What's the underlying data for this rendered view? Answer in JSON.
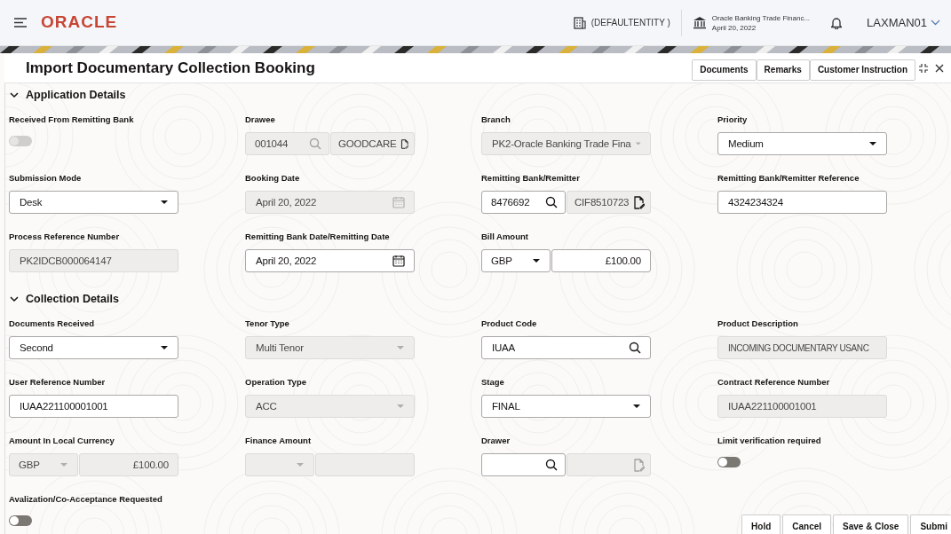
{
  "header": {
    "logo": "ORACLE",
    "entity": "(DEFAULTENTITY )",
    "branch_name": "Oracle Banking Trade Financ...",
    "branch_date": "April 20, 2022",
    "user": "LAXMAN01"
  },
  "window": {
    "title": "Import Documentary Collection Booking",
    "actions": [
      "Documents",
      "Remarks",
      "Customer Instruction"
    ]
  },
  "sections": [
    {
      "title": "Application Details",
      "expanded": true,
      "fields": [
        {
          "label": "Received From Remitting Bank",
          "kind": "toggle",
          "on": false,
          "disabled": true
        },
        {
          "label": "Drawee",
          "kind": "lookup",
          "value": "001044",
          "name": "GOODCARE",
          "disabled": true
        },
        {
          "label": "Branch",
          "kind": "select",
          "value": "PK2-Oracle Banking Trade Fina",
          "disabled": true
        },
        {
          "label": "Priority",
          "kind": "select",
          "value": "Medium",
          "disabled": false
        },
        {
          "label": "Submission Mode",
          "kind": "select",
          "value": "Desk",
          "disabled": false
        },
        {
          "label": "Booking Date",
          "kind": "date",
          "value": "April 20, 2022",
          "disabled": true
        },
        {
          "label": "Remitting Bank/Remitter",
          "kind": "lookup",
          "value": "8476692",
          "name": "CIF8510723",
          "disabled": false
        },
        {
          "label": "Remitting Bank/Remitter Reference",
          "kind": "text",
          "value": "4324234324",
          "disabled": false
        },
        {
          "label": "Process Reference Number",
          "kind": "text",
          "value": "PK2IDCB000064147",
          "disabled": true
        },
        {
          "label": "Remitting Bank Date/Remitting Date",
          "kind": "date",
          "value": "April 20, 2022",
          "disabled": false
        },
        {
          "label": "Bill Amount",
          "kind": "amount",
          "currency": "GBP",
          "amount": "£100.00",
          "disabled": false
        }
      ]
    },
    {
      "title": "Collection Details",
      "expanded": true,
      "fields": [
        {
          "label": "Documents Received",
          "kind": "select",
          "value": "Second",
          "disabled": false
        },
        {
          "label": "Tenor Type",
          "kind": "select",
          "value": "Multi Tenor",
          "disabled": true
        },
        {
          "label": "Product Code",
          "kind": "search",
          "value": "IUAA",
          "disabled": false
        },
        {
          "label": "Product Description",
          "kind": "text",
          "value": "INCOMING DOCUMENTARY USANC",
          "disabled": true
        },
        {
          "label": "User Reference Number",
          "kind": "text",
          "value": "IUAA221100001001",
          "disabled": false
        },
        {
          "label": "Operation Type",
          "kind": "select",
          "value": "ACC",
          "disabled": true
        },
        {
          "label": "Stage",
          "kind": "select",
          "value": "FINAL",
          "disabled": false
        },
        {
          "label": "Contract Reference Number",
          "kind": "text",
          "value": "IUAA221100001001",
          "disabled": true
        },
        {
          "label": "Amount In Local Currency",
          "kind": "amount",
          "currency": "GBP",
          "amount": "£100.00",
          "disabled": true
        },
        {
          "label": "Finance Amount",
          "kind": "amount",
          "disabled": true
        },
        {
          "label": "Drawer",
          "kind": "lookup",
          "disabled": false
        },
        {
          "label": "Limit verification required",
          "kind": "toggle",
          "on": false,
          "disabled": false
        },
        {
          "label": "Avalization/Co-Acceptance Requested",
          "kind": "toggle",
          "on": false,
          "disabled": false
        }
      ]
    }
  ],
  "footer_buttons": [
    "Hold",
    "Cancel",
    "Save & Close",
    "Submi"
  ]
}
